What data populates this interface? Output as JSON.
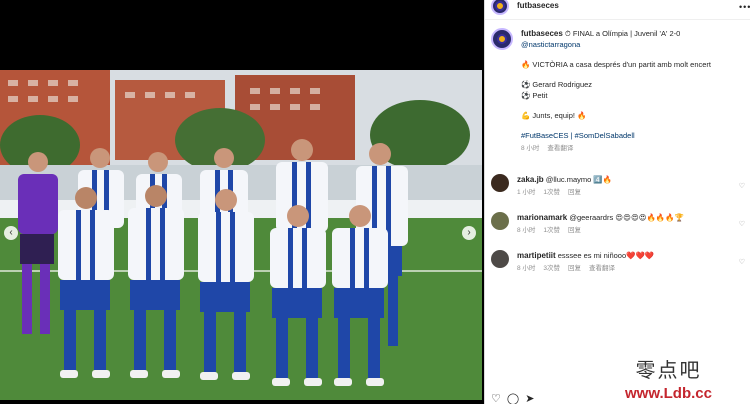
{
  "post": {
    "username": "futbaseces",
    "more_icon": "ellipsis-icon"
  },
  "caption": {
    "username": "futbaseces",
    "line1": "⏱ FINAL a Olímpia | Juvenil 'A' 2-0",
    "mention": "@nastictarragona",
    "line2": "🔥 VICTÒRIA a casa després d'un partit amb molt encert",
    "scorer1": "⚽ Gerard Rodriguez",
    "scorer2": "⚽ Petit",
    "line3": "💪 Junts, equip! 🔥",
    "hashtags": "#FutBaseCES | #SomDelSabadell",
    "time": "8 小时",
    "translate": "查看翻译"
  },
  "comments": [
    {
      "username": "zaka.jb",
      "text": "@lluc.maymo 4️⃣🔥",
      "time": "1 小时",
      "likes": "1次赞",
      "reply": "回复",
      "avatar_color": "#3b2a1f"
    },
    {
      "username": "marionamark",
      "text": "@geeraardrs 😍😍😍😍🔥🔥🔥🏆",
      "time": "8 小时",
      "likes": "1次赞",
      "reply": "回复",
      "avatar_color": "#6b6f4a"
    },
    {
      "username": "martipetiit",
      "text": "esssee es mi niñooo❤️❤️❤️",
      "time": "8 小时",
      "likes": "3次赞",
      "reply": "回复",
      "translate": "查看翻译",
      "avatar_color": "#4e4a47"
    }
  ],
  "watermark": {
    "top": "零点吧",
    "url": "www.Ldb.cc"
  },
  "colors": {
    "pitch": "#4f8a3a",
    "kit_blue": "#1f47a8",
    "keeper": "#6a2fb8"
  }
}
